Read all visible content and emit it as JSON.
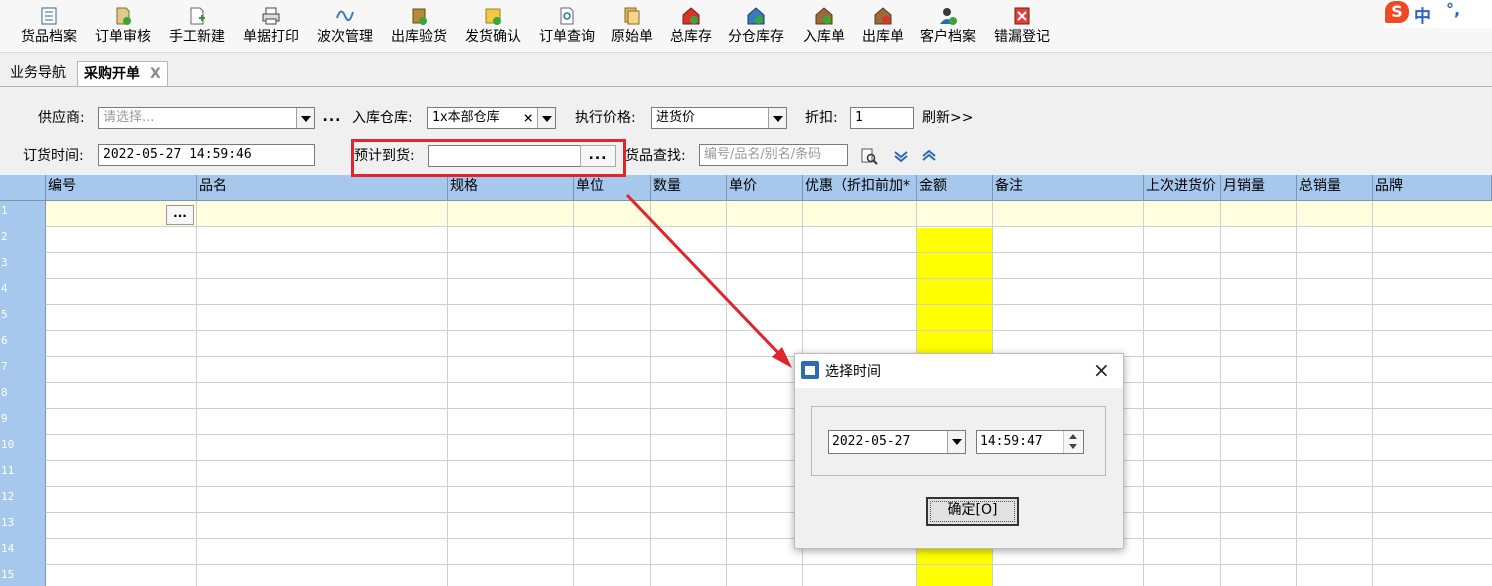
{
  "toolbar": {
    "items": [
      {
        "label": "货品档案",
        "icon": "product-archive-icon"
      },
      {
        "label": "订单审核",
        "icon": "order-review-icon"
      },
      {
        "label": "手工新建",
        "icon": "manual-new-icon"
      },
      {
        "label": "单据打印",
        "icon": "printer-icon"
      },
      {
        "label": "波次管理",
        "icon": "wave-icon"
      },
      {
        "label": "出库验货",
        "icon": "outbound-check-icon"
      },
      {
        "label": "发货确认",
        "icon": "shipping-confirm-icon"
      },
      {
        "label": "订单查询",
        "icon": "order-query-icon"
      },
      {
        "label": "原始单",
        "icon": "original-doc-icon"
      },
      {
        "label": "总库存",
        "icon": "total-stock-icon"
      },
      {
        "label": "分仓库存",
        "icon": "branch-stock-icon"
      },
      {
        "label": "入库单",
        "icon": "inbound-doc-icon"
      },
      {
        "label": "出库单",
        "icon": "outbound-doc-icon"
      },
      {
        "label": "客户档案",
        "icon": "customer-archive-icon"
      },
      {
        "label": "错漏登记",
        "icon": "error-register-icon"
      }
    ],
    "ime": {
      "logo": "S",
      "mode": "中",
      "punct": "°,"
    }
  },
  "tabs": [
    {
      "label": "业务导航"
    },
    {
      "label": "采购开单",
      "close": "X"
    }
  ],
  "form": {
    "supplier_label": "供应商:",
    "supplier_placeholder": "请选择...",
    "supplier_dots": "...",
    "warehouse_label": "入库仓库:",
    "warehouse_value": "1x本部仓库",
    "warehouse_clear": "×",
    "price_label": "执行价格:",
    "price_value": "进货价",
    "discount_label": "折扣:",
    "discount_value": "1",
    "refresh_label": "刷新>>",
    "order_time_label": "订货时间:",
    "order_time_value": "2022-05-27 14:59:46",
    "expected_label": "预计到货:",
    "expected_value": "",
    "expected_dots": "...",
    "search_label": "货品查找:",
    "search_placeholder": "编号/品名/别名/条码"
  },
  "grid": {
    "columns": [
      "编号",
      "品名",
      "规格",
      "单位",
      "数量",
      "单价",
      "优惠（折扣前加*",
      "金额",
      "备注",
      "上次进货价",
      "月销量",
      "总销量",
      "品牌"
    ],
    "rows": [
      "1",
      "2",
      "3",
      "4",
      "5",
      "6",
      "7",
      "8",
      "9",
      "10",
      "11",
      "12",
      "13",
      "14",
      "15"
    ],
    "cell_button": "...",
    "colors": {
      "header": "#a5c8ec",
      "amount_col": "#ffff00",
      "current_row": "#ffffe0"
    }
  },
  "dialog": {
    "title": "选择时间",
    "close": "×",
    "date_value": "2022-05-27",
    "time_value": "14:59:47",
    "ok_label": "确定[O]"
  },
  "annotation": {
    "color": "#e0252d"
  }
}
